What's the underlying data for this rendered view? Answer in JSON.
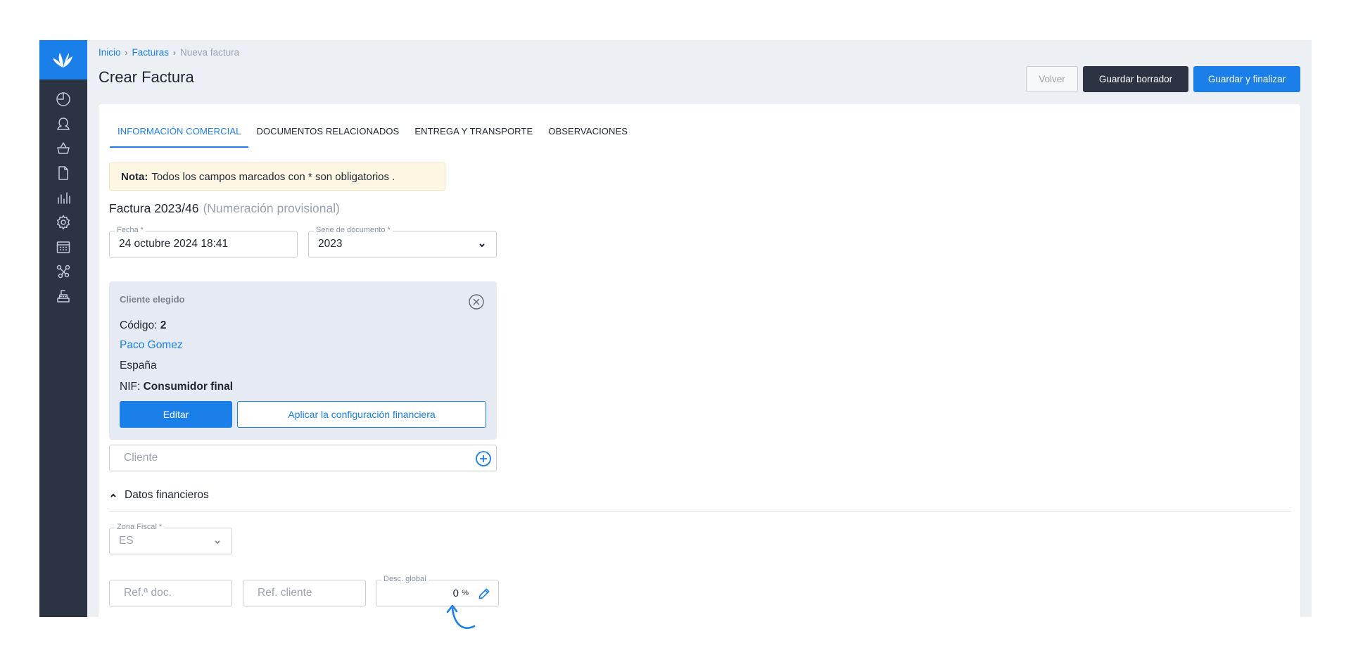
{
  "breadcrumb": {
    "home": "Inicio",
    "invoices": "Facturas",
    "current": "Nueva factura"
  },
  "header": {
    "title": "Crear Factura",
    "back_label": "Volver",
    "save_draft_label": "Guardar borrador",
    "save_finalize_label": "Guardar y finalizar"
  },
  "sidebar": {
    "items": [
      {
        "icon": "dashboard-icon"
      },
      {
        "icon": "user-icon"
      },
      {
        "icon": "basket-icon"
      },
      {
        "icon": "document-icon"
      },
      {
        "icon": "bar-chart-icon"
      },
      {
        "icon": "gear-icon"
      },
      {
        "icon": "calendar-icon"
      },
      {
        "icon": "integrations-icon"
      },
      {
        "icon": "cash-register-icon"
      }
    ]
  },
  "tabs": [
    {
      "label": "INFORMACIÓN COMERCIAL",
      "active": true
    },
    {
      "label": "DOCUMENTOS RELACIONADOS"
    },
    {
      "label": "ENTREGA Y TRANSPORTE"
    },
    {
      "label": "OBSERVACIONES"
    }
  ],
  "note": {
    "bold": "Nota:",
    "text": "Todos los campos marcados con * son obligatorios ."
  },
  "invoice": {
    "number": "Factura 2023/46",
    "provisional": "(Numeración provisional)"
  },
  "fields": {
    "fecha": {
      "label": "Fecha *",
      "value": "24 octubre 2024 18:41"
    },
    "serie": {
      "label": "Serie de documento *",
      "value": "2023"
    }
  },
  "client": {
    "title": "Cliente elegido",
    "code_label": "Código:",
    "code": "2",
    "name": "Paco Gomez",
    "country": "España",
    "nif_label": "NIF:",
    "nif": "Consumidor final",
    "edit_label": "Editar",
    "apply_label": "Aplicar la configuración financiera",
    "search_placeholder": "Cliente"
  },
  "financial": {
    "section_title": "Datos financieros",
    "zona_label": "Zona Fiscal *",
    "zona_value": "ES",
    "ref_doc_placeholder": "Ref.ª doc.",
    "ref_cliente_placeholder": "Ref. cliente",
    "desc_label": "Desc. global",
    "desc_value": "0",
    "desc_unit": "%"
  },
  "colors": {
    "accent": "#1a7fe8",
    "sidebar": "#2c3444",
    "note_bg": "#fdf6e3"
  }
}
